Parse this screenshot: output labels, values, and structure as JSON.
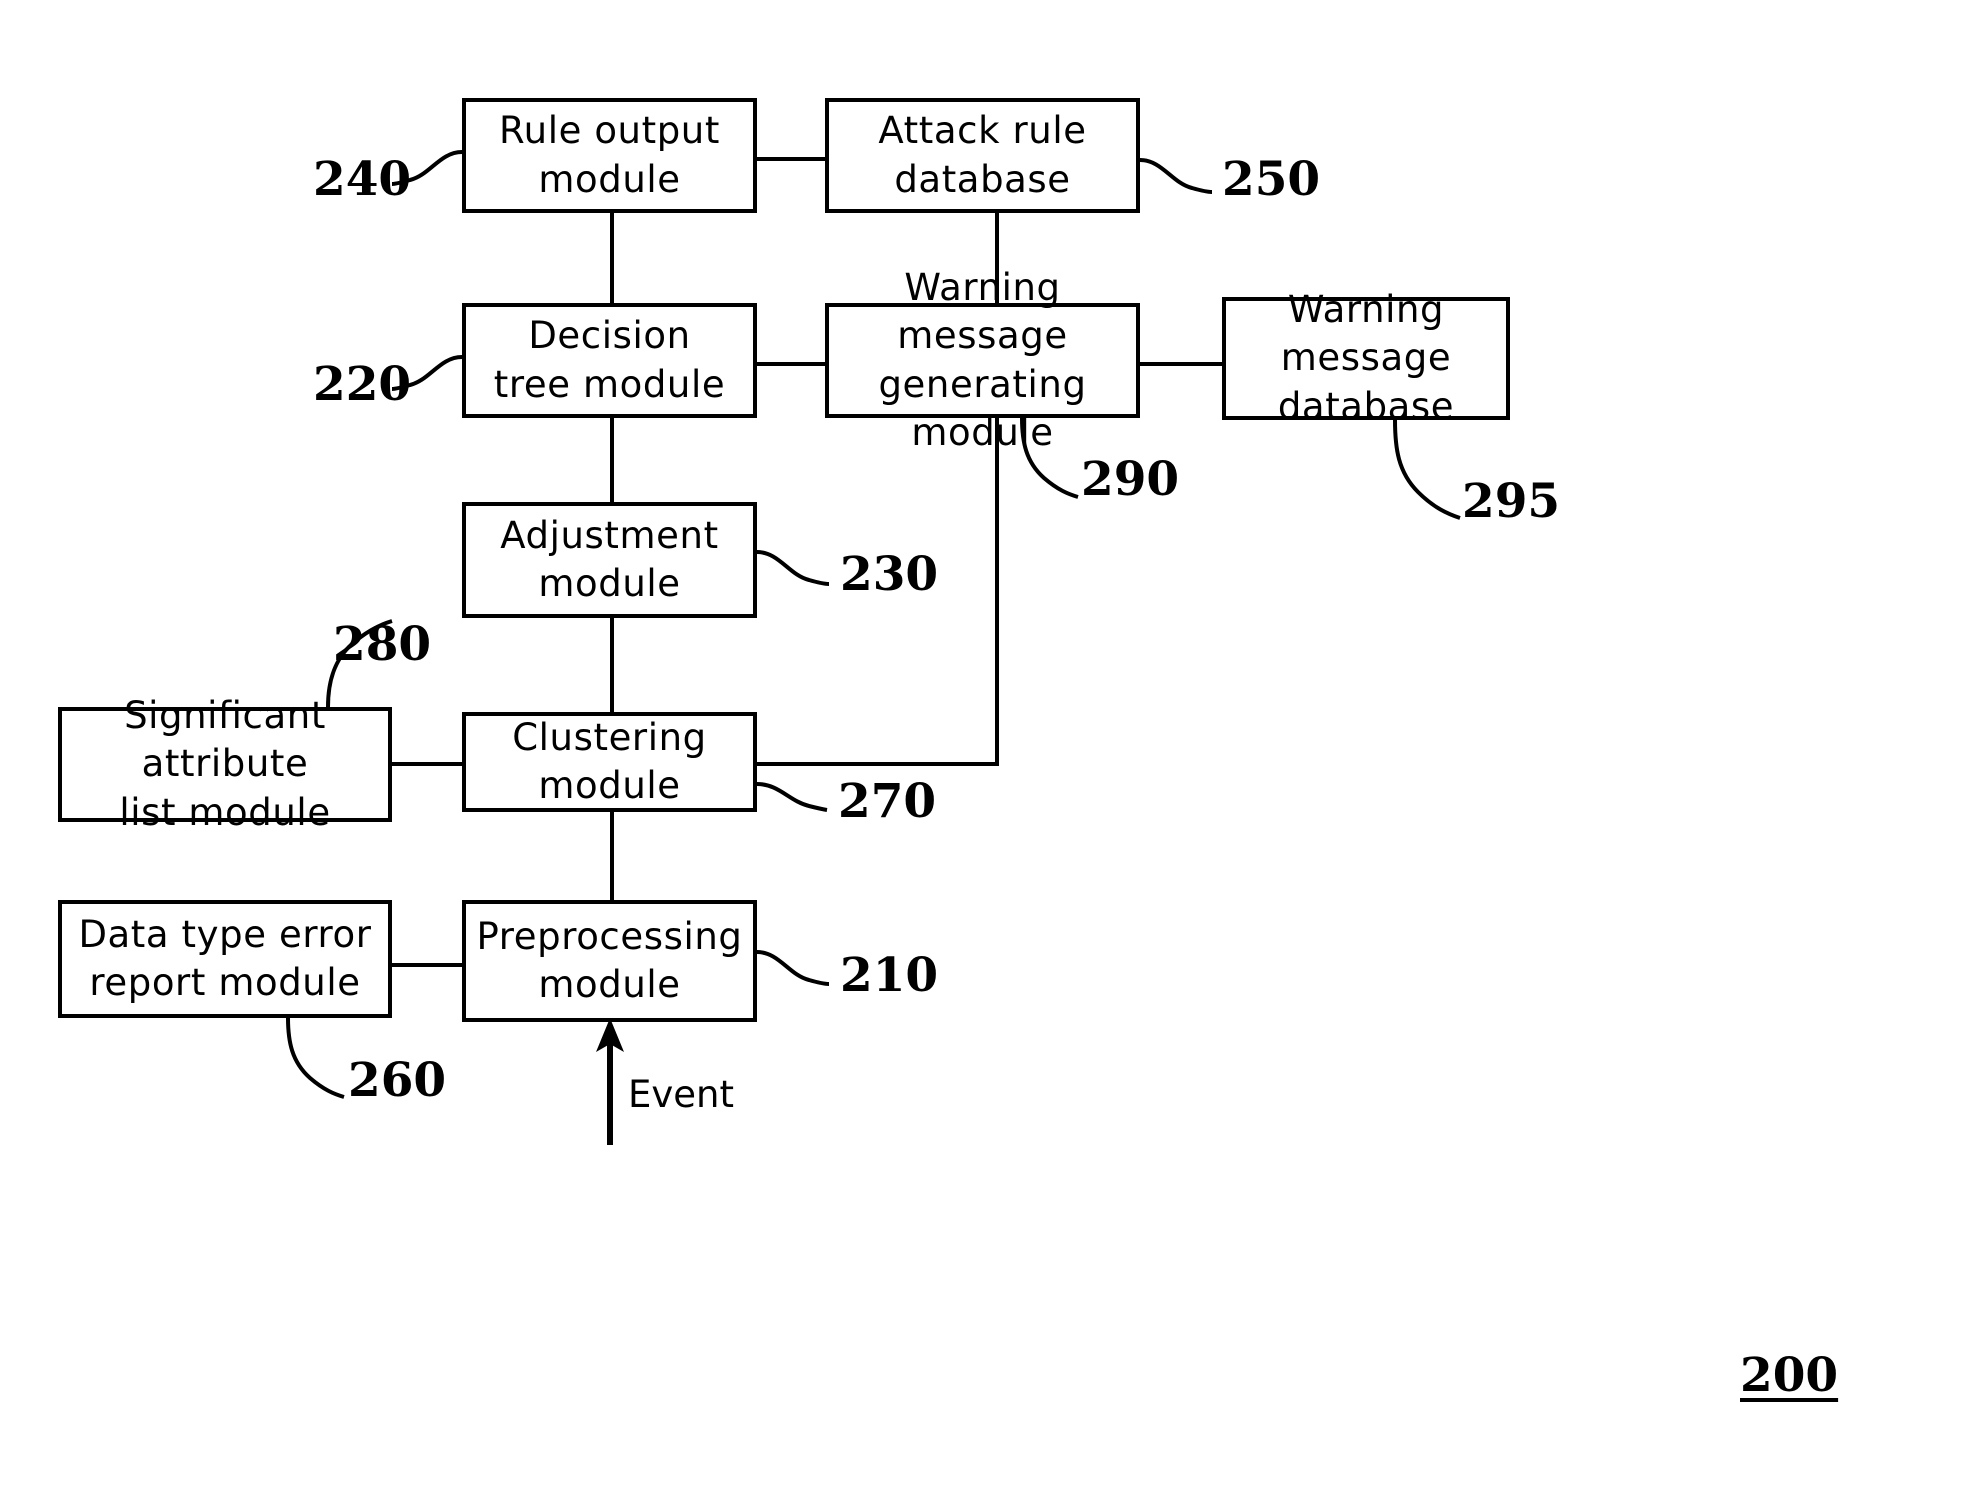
{
  "figure": {
    "number": "200",
    "input_label": "Event"
  },
  "boxes": [
    {
      "id": "rule_output",
      "label": "Rule output\nmodule",
      "ref": "240"
    },
    {
      "id": "attack_rule_db",
      "label": "Attack rule\ndatabase",
      "ref": "250"
    },
    {
      "id": "decision_tree",
      "label": "Decision\ntree module",
      "ref": "220"
    },
    {
      "id": "warning_gen",
      "label": "Warning message\ngenerating module",
      "ref": "290"
    },
    {
      "id": "warning_db",
      "label": "Warning message\ndatabase",
      "ref": "295"
    },
    {
      "id": "adjustment",
      "label": "Adjustment\nmodule",
      "ref": "230"
    },
    {
      "id": "significant_attr",
      "label": "Significant attribute\nlist module",
      "ref": "280"
    },
    {
      "id": "clustering",
      "label": "Clustering module",
      "ref": "270"
    },
    {
      "id": "data_type_error",
      "label": "Data type error\nreport module",
      "ref": "260"
    },
    {
      "id": "preprocessing",
      "label": "Preprocessing\nmodule",
      "ref": "210"
    }
  ],
  "colors": {
    "stroke": "#000000",
    "background": "#ffffff"
  }
}
